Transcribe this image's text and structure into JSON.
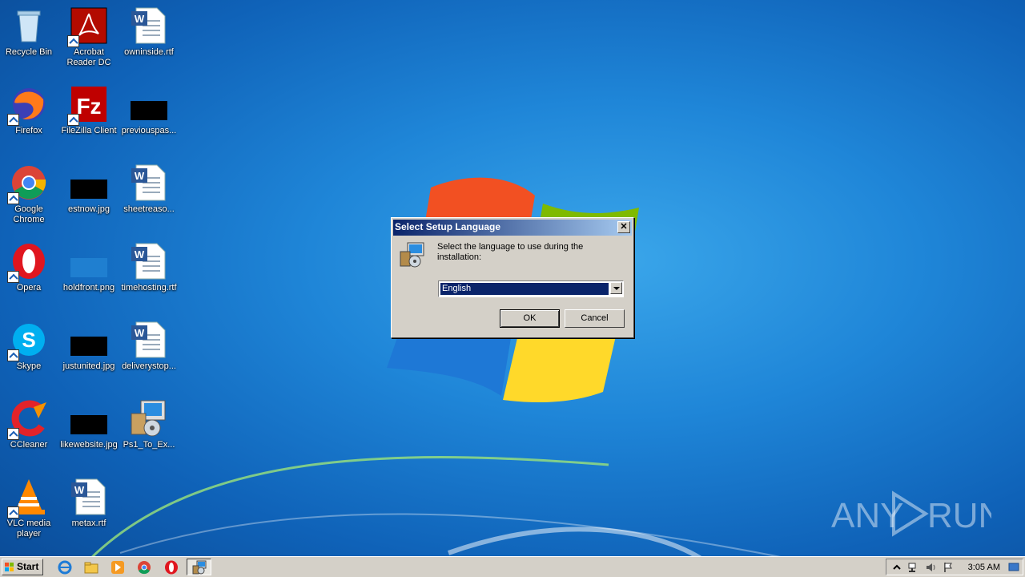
{
  "desktop": {
    "icons": [
      {
        "label": "Recycle Bin",
        "icon": "recycle-bin-icon"
      },
      {
        "label": "Acrobat Reader DC",
        "icon": "acrobat-icon"
      },
      {
        "label": "owninside.rtf",
        "icon": "word-doc-icon"
      },
      {
        "label": "Firefox",
        "icon": "firefox-icon"
      },
      {
        "label": "FileZilla Client",
        "icon": "filezilla-icon"
      },
      {
        "label": "previouspas...",
        "icon": "image-file-icon"
      },
      {
        "label": "Google Chrome",
        "icon": "chrome-icon"
      },
      {
        "label": "estnow.jpg",
        "icon": "image-file-icon"
      },
      {
        "label": "sheetreaso...",
        "icon": "word-doc-icon"
      },
      {
        "label": "Opera",
        "icon": "opera-icon"
      },
      {
        "label": "holdfront.png",
        "icon": "image-file-icon"
      },
      {
        "label": "timehosting.rtf",
        "icon": "word-doc-icon"
      },
      {
        "label": "Skype",
        "icon": "skype-icon"
      },
      {
        "label": "justunited.jpg",
        "icon": "image-file-icon"
      },
      {
        "label": "deliverystop...",
        "icon": "word-doc-icon"
      },
      {
        "label": "CCleaner",
        "icon": "ccleaner-icon"
      },
      {
        "label": "likewebsite.jpg",
        "icon": "image-file-icon"
      },
      {
        "label": "Ps1_To_Ex...",
        "icon": "setup-icon"
      },
      {
        "label": "VLC media player",
        "icon": "vlc-icon"
      },
      {
        "label": "metax.rtf",
        "icon": "word-doc-icon"
      }
    ]
  },
  "dialog": {
    "title": "Select Setup Language",
    "close_label": "✕",
    "prompt": "Select the language to use during the installation:",
    "language": {
      "selected": "English"
    },
    "ok_label": "OK",
    "cancel_label": "Cancel"
  },
  "taskbar": {
    "start_label": "Start",
    "clock": "3:05 AM"
  },
  "watermark": {
    "text_left": "ANY",
    "text_right": "RUN"
  },
  "colors": {
    "title_bar": "#0a246a",
    "selection": "#0a246a",
    "face": "#d4d0c8"
  }
}
